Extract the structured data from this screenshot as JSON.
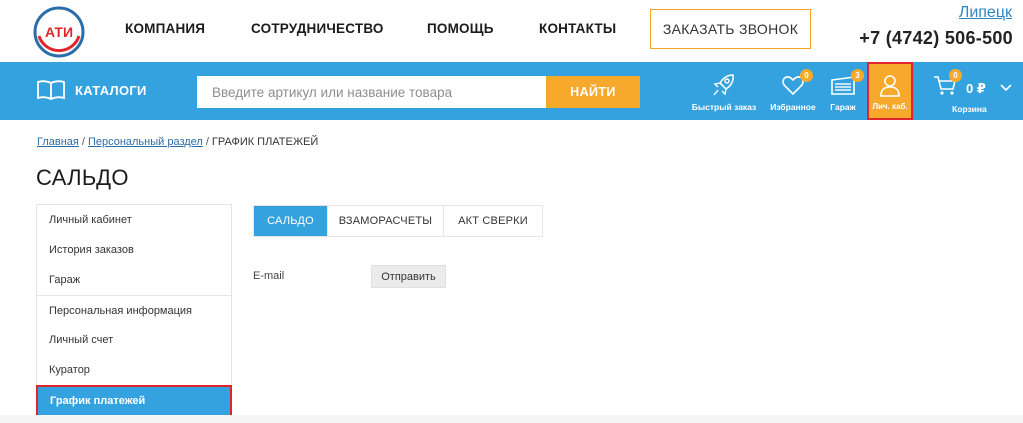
{
  "logo": {
    "text": "АТИ"
  },
  "nav": [
    "КОМПАНИЯ",
    "СОТРУДНИЧЕСТВО",
    "ПОМОЩЬ",
    "КОНТАКТЫ"
  ],
  "call_button": "ЗАКАЗАТЬ ЗВОНОК",
  "city": "Липецк",
  "phone": "+7 (4742) 506-500",
  "catalogs_label": "КАТАЛОГИ",
  "search": {
    "placeholder": "Введите артикул или название товара",
    "button": "НАЙТИ"
  },
  "toolbar": {
    "quick_order": "Быстрый заказ",
    "favorites": {
      "label": "Избранное",
      "count": "0"
    },
    "garage": {
      "label": "Гараж",
      "count": "3"
    },
    "account": "Лич. каб.",
    "cart": {
      "label": "Корзина",
      "count": "0",
      "amount": "0 ₽"
    }
  },
  "breadcrumb": {
    "home": "Главная",
    "section": "Персональный раздел",
    "current": "ГРАФИК ПЛАТЕЖЕЙ",
    "sep": "/"
  },
  "page_title": "САЛЬДО",
  "sidebar": {
    "items": [
      {
        "label": "Личный кабинет"
      },
      {
        "label": "История заказов"
      },
      {
        "label": "Гараж"
      },
      {
        "label": "Персональная информация"
      },
      {
        "label": "Личный счет"
      },
      {
        "label": "Куратор"
      },
      {
        "label": "График платежей"
      }
    ]
  },
  "tabs": [
    {
      "label": "САЛЬДО"
    },
    {
      "label": "ВЗАМОРАСЧЕТЫ"
    },
    {
      "label": "АКТ СВЕРКИ"
    }
  ],
  "form": {
    "email_label": "E-mail",
    "send_button": "Отправить"
  },
  "colors": {
    "brand_blue": "#35a2e0",
    "accent_orange": "#f7a92c",
    "highlight_red": "#e0262c"
  }
}
